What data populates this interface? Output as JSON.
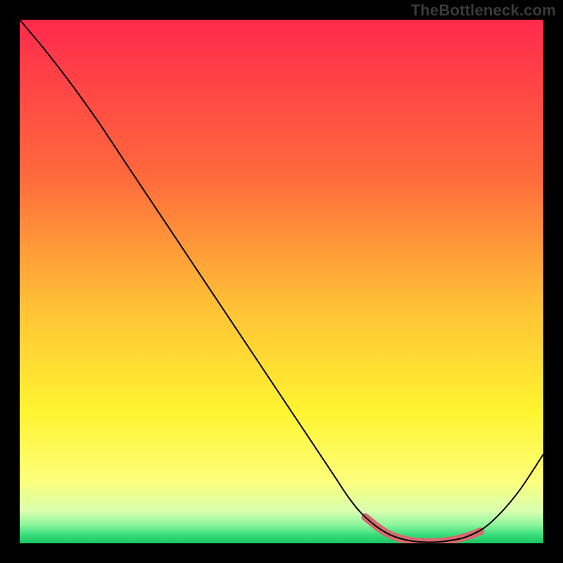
{
  "watermark": "TheBottleneck.com",
  "chart_data": {
    "type": "line",
    "title": "",
    "xlabel": "",
    "ylabel": "",
    "xlim": [
      0,
      100
    ],
    "ylim": [
      0,
      100
    ],
    "grid": false,
    "series": [
      {
        "name": "bottleneck-curve",
        "x": [
          0,
          5,
          10,
          15,
          20,
          25,
          30,
          35,
          40,
          45,
          50,
          55,
          60,
          63,
          66,
          70,
          74,
          78,
          82,
          86,
          90,
          95,
          100
        ],
        "y": [
          100,
          94.0,
          87.5,
          80.5,
          73.0,
          65.5,
          58.0,
          50.5,
          43.0,
          35.5,
          28.0,
          20.5,
          13.0,
          8.5,
          5.0,
          2.0,
          0.6,
          0.2,
          0.5,
          1.5,
          4.0,
          9.5,
          17.0
        ]
      },
      {
        "name": "optimal-range-marker",
        "x": [
          66,
          70,
          74,
          78,
          82,
          86,
          88
        ],
        "y": [
          5.0,
          2.0,
          0.6,
          0.2,
          0.5,
          1.5,
          2.3
        ]
      }
    ],
    "gradient_stops": [
      {
        "offset": 0.0,
        "color": "#ff2a4c"
      },
      {
        "offset": 0.3,
        "color": "#ff6a3c"
      },
      {
        "offset": 0.55,
        "color": "#ffc236"
      },
      {
        "offset": 0.75,
        "color": "#fff430"
      },
      {
        "offset": 0.88,
        "color": "#fdff7a"
      },
      {
        "offset": 0.94,
        "color": "#d7ffb0"
      },
      {
        "offset": 0.965,
        "color": "#8cf59c"
      },
      {
        "offset": 0.982,
        "color": "#3ee07e"
      },
      {
        "offset": 1.0,
        "color": "#18c661"
      }
    ],
    "marker_color": "#d66a6e"
  }
}
